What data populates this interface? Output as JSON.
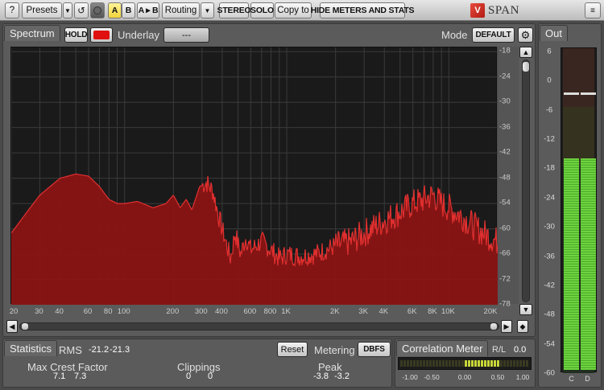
{
  "toolbar": {
    "help": "?",
    "presets": "Presets",
    "undo_icon": "undo-icon",
    "a": "A",
    "b": "B",
    "a_to_b": "A ▸ B",
    "routing": "Routing",
    "stereo": "STEREO",
    "solo": "SOLO",
    "copy_to": "Copy to",
    "hide_meters": "HIDE METERS AND STATS",
    "logo_text": "SPAN",
    "logo_mark": "V"
  },
  "spectrum": {
    "tab": "Spectrum",
    "hold": "HOLD",
    "hold_color": "#e01010",
    "underlay_label": "Underlay",
    "underlay_value": "---",
    "mode_label": "Mode",
    "mode_value": "DEFAULT",
    "db_ticks": [
      "-18",
      "-24",
      "-30",
      "-36",
      "-42",
      "-48",
      "-54",
      "-60",
      "-66",
      "-72",
      "-78"
    ],
    "freq_ticks": [
      "20",
      "30",
      "40",
      "60",
      "80",
      "100",
      "200",
      "300",
      "400",
      "600",
      "800",
      "1K",
      "2K",
      "3K",
      "4K",
      "6K",
      "8K",
      "10K",
      "20K"
    ],
    "fill_color": "#8a1414",
    "line_color": "#e23030"
  },
  "out": {
    "tab": "Out",
    "ticks": [
      "6",
      "0",
      "-6",
      "-12",
      "-18",
      "-24",
      "-30",
      "-36",
      "-42",
      "-48",
      "-54",
      "-60"
    ],
    "channels": [
      "C",
      "D"
    ],
    "level_db": [
      -17,
      -17
    ],
    "peak_db": [
      -3,
      -3
    ]
  },
  "stats": {
    "tab": "Statistics",
    "rms_label": "RMS",
    "rms_l": "-21.2",
    "rms_r": "-21.3",
    "reset": "Reset",
    "metering_label": "Metering",
    "metering_value": "DBFS",
    "crest_label": "Max Crest Factor",
    "crest_l": "7.1",
    "crest_r": "7.3",
    "clip_label": "Clippings",
    "clip_l": "0",
    "clip_r": "0",
    "peak_label": "Peak",
    "peak_l": "-3.8",
    "peak_r": "-3.2"
  },
  "correlation": {
    "tab": "Correlation Meter",
    "rl_label": "R/L",
    "rl_value": "0.0",
    "ticks": [
      "-1.00",
      "-0.50",
      "0.00",
      "0.50",
      "1.00"
    ],
    "value": 0.55
  }
}
